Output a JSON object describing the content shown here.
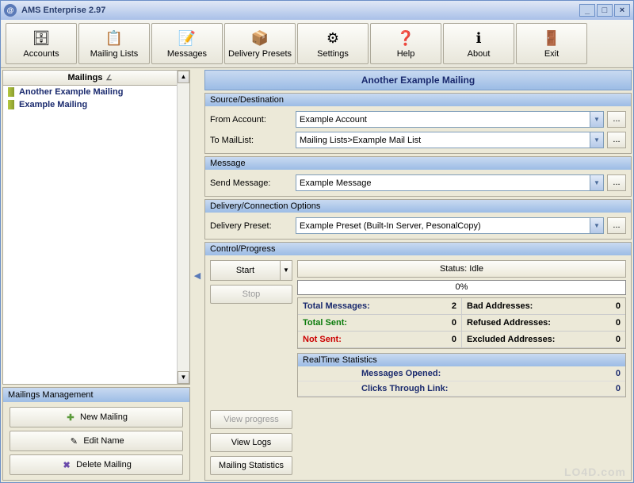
{
  "window": {
    "title": "AMS Enterprise 2.97"
  },
  "toolbar": [
    {
      "name": "accounts",
      "label": "Accounts",
      "icon": "🗄"
    },
    {
      "name": "mailing-lists",
      "label": "Mailing Lists",
      "icon": "📋"
    },
    {
      "name": "messages",
      "label": "Messages",
      "icon": "📝"
    },
    {
      "name": "delivery-presets",
      "label": "Delivery Presets",
      "icon": "📦"
    },
    {
      "name": "settings",
      "label": "Settings",
      "icon": "⚙"
    },
    {
      "name": "help",
      "label": "Help",
      "icon": "❓"
    },
    {
      "name": "about",
      "label": "About",
      "icon": "ℹ"
    },
    {
      "name": "exit",
      "label": "Exit",
      "icon": "🚪"
    }
  ],
  "sidebar": {
    "header": "Mailings",
    "items": [
      {
        "label": "Another Example Mailing"
      },
      {
        "label": "Example Mailing"
      }
    ]
  },
  "management": {
    "header": "Mailings Management",
    "new_label": "New Mailing",
    "edit_label": "Edit Name",
    "delete_label": "Delete Mailing"
  },
  "main": {
    "title": "Another Example Mailing",
    "sections": {
      "source": {
        "header": "Source/Destination",
        "from_label": "From Account:",
        "from_value": "Example Account",
        "to_label": "To MailList:",
        "to_value": "Mailing Lists>Example Mail List"
      },
      "message": {
        "header": "Message",
        "send_label": "Send Message:",
        "send_value": "Example Message"
      },
      "delivery": {
        "header": "Delivery/Connection Options",
        "preset_label": "Delivery Preset:",
        "preset_value": "Example Preset (Built-In Server, PesonalCopy)"
      },
      "control": {
        "header": "Control/Progress",
        "start_label": "Start",
        "stop_label": "Stop",
        "view_progress_label": "View progress",
        "view_logs_label": "View Logs",
        "mailing_stats_label": "Mailing Statistics",
        "status_label": "Status: Idle",
        "progress_text": "0%",
        "stats": {
          "total_messages_label": "Total Messages:",
          "total_messages_value": "2",
          "bad_addresses_label": "Bad Addresses:",
          "bad_addresses_value": "0",
          "total_sent_label": "Total Sent:",
          "total_sent_value": "0",
          "refused_label": "Refused Addresses:",
          "refused_value": "0",
          "not_sent_label": "Not Sent:",
          "not_sent_value": "0",
          "excluded_label": "Excluded Addresses:",
          "excluded_value": "0"
        },
        "realtime": {
          "header": "RealTime Statistics",
          "opened_label": "Messages Opened:",
          "opened_value": "0",
          "clicks_label": "Clicks Through Link:",
          "clicks_value": "0"
        }
      }
    }
  },
  "watermark": "LO4D.com"
}
